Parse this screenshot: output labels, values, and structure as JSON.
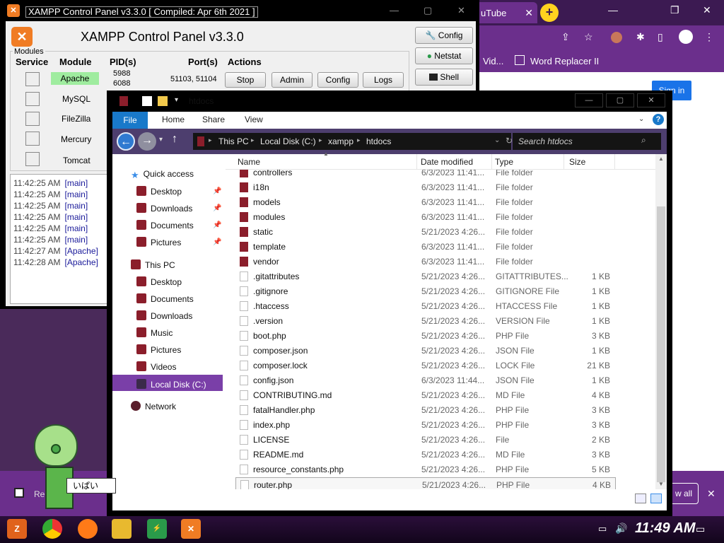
{
  "chrome": {
    "tab_title": "uTube",
    "bookmarks": [
      "Vid...",
      "Word Replacer II"
    ],
    "sign_in": "Sign in",
    "show_all": "w all"
  },
  "banner_left_text": "Re",
  "xampp": {
    "window_title": "XAMPP Control Panel v3.3.0   [ Compiled: Apr 6th 2021 ]",
    "heading": "XAMPP Control Panel v3.3.0",
    "modules_label": "Modules",
    "headers": {
      "service": "Service",
      "module": "Module",
      "pids": "PID(s)",
      "ports": "Port(s)",
      "actions": "Actions"
    },
    "side_buttons": {
      "config": "Config",
      "netstat": "Netstat",
      "shell": "Shell"
    },
    "modules": [
      {
        "name": "Apache",
        "pid1": "5988",
        "pid2": "6088",
        "ports": "51103, 51104",
        "stop": "Stop",
        "admin": "Admin",
        "config": "Config",
        "logs": "Logs",
        "running": true
      },
      {
        "name": "MySQL"
      },
      {
        "name": "FileZilla"
      },
      {
        "name": "Mercury"
      },
      {
        "name": "Tomcat"
      }
    ],
    "log": [
      {
        "time": "11:42:25 AM",
        "src": "[main]"
      },
      {
        "time": "11:42:25 AM",
        "src": "[main]"
      },
      {
        "time": "11:42:25 AM",
        "src": "[main]"
      },
      {
        "time": "11:42:25 AM",
        "src": "[main]"
      },
      {
        "time": "11:42:25 AM",
        "src": "[main]"
      },
      {
        "time": "11:42:25 AM",
        "src": "[main]"
      },
      {
        "time": "11:42:27 AM",
        "src": "[Apache]"
      },
      {
        "time": "11:42:28 AM",
        "src": "[Apache]"
      }
    ]
  },
  "explorer": {
    "window_title": "htdocs",
    "ribbon": {
      "file": "File",
      "home": "Home",
      "share": "Share",
      "view": "View"
    },
    "breadcrumb": [
      "This PC",
      "Local Disk (C:)",
      "xampp",
      "htdocs"
    ],
    "search_placeholder": "Search htdocs",
    "columns": {
      "name": "Name",
      "date": "Date modified",
      "type": "Type",
      "size": "Size"
    },
    "nav": {
      "quick_access": "Quick access",
      "qa_items": [
        "Desktop",
        "Downloads",
        "Documents",
        "Pictures"
      ],
      "this_pc": "This PC",
      "pc_items": [
        "Desktop",
        "Documents",
        "Downloads",
        "Music",
        "Pictures",
        "Videos"
      ],
      "local_disk": "Local Disk (C:)",
      "network": "Network"
    },
    "files": [
      {
        "name": "controllers",
        "date": "6/3/2023 11:41...",
        "type": "File folder",
        "size": "",
        "folder": true
      },
      {
        "name": "i18n",
        "date": "6/3/2023 11:41...",
        "type": "File folder",
        "size": "",
        "folder": true
      },
      {
        "name": "models",
        "date": "6/3/2023 11:41...",
        "type": "File folder",
        "size": "",
        "folder": true
      },
      {
        "name": "modules",
        "date": "6/3/2023 11:41...",
        "type": "File folder",
        "size": "",
        "folder": true
      },
      {
        "name": "static",
        "date": "5/21/2023 4:26...",
        "type": "File folder",
        "size": "",
        "folder": true
      },
      {
        "name": "template",
        "date": "6/3/2023 11:41...",
        "type": "File folder",
        "size": "",
        "folder": true
      },
      {
        "name": "vendor",
        "date": "6/3/2023 11:41...",
        "type": "File folder",
        "size": "",
        "folder": true
      },
      {
        "name": ".gitattributes",
        "date": "5/21/2023 4:26...",
        "type": "GITATTRIBUTES...",
        "size": "1 KB"
      },
      {
        "name": ".gitignore",
        "date": "5/21/2023 4:26...",
        "type": "GITIGNORE File",
        "size": "1 KB"
      },
      {
        "name": ".htaccess",
        "date": "5/21/2023 4:26...",
        "type": "HTACCESS File",
        "size": "1 KB"
      },
      {
        "name": ".version",
        "date": "5/21/2023 4:26...",
        "type": "VERSION File",
        "size": "1 KB"
      },
      {
        "name": "boot.php",
        "date": "5/21/2023 4:26...",
        "type": "PHP File",
        "size": "3 KB"
      },
      {
        "name": "composer.json",
        "date": "5/21/2023 4:26...",
        "type": "JSON File",
        "size": "1 KB"
      },
      {
        "name": "composer.lock",
        "date": "5/21/2023 4:26...",
        "type": "LOCK File",
        "size": "21 KB"
      },
      {
        "name": "config.json",
        "date": "6/3/2023 11:44...",
        "type": "JSON File",
        "size": "1 KB"
      },
      {
        "name": "CONTRIBUTING.md",
        "date": "5/21/2023 4:26...",
        "type": "MD File",
        "size": "4 KB"
      },
      {
        "name": "fatalHandler.php",
        "date": "5/21/2023 4:26...",
        "type": "PHP File",
        "size": "3 KB"
      },
      {
        "name": "index.php",
        "date": "5/21/2023 4:26...",
        "type": "PHP File",
        "size": "3 KB"
      },
      {
        "name": "LICENSE",
        "date": "5/21/2023 4:26...",
        "type": "File",
        "size": "2 KB"
      },
      {
        "name": "README.md",
        "date": "5/21/2023 4:26...",
        "type": "MD File",
        "size": "3 KB"
      },
      {
        "name": "resource_constants.php",
        "date": "5/21/2023 4:26...",
        "type": "PHP File",
        "size": "5 KB"
      },
      {
        "name": "router.php",
        "date": "5/21/2023 4:26...",
        "type": "PHP File",
        "size": "4 KB",
        "selected": true
      }
    ]
  },
  "sticker_text": "いぱい",
  "clock": "11:49 AM",
  "colors": {
    "accent": "#6b2f8c",
    "explorer_blue": "#1979ca",
    "folder_red": "#8b1e2b",
    "selected_nav": "#7a3fa8"
  }
}
